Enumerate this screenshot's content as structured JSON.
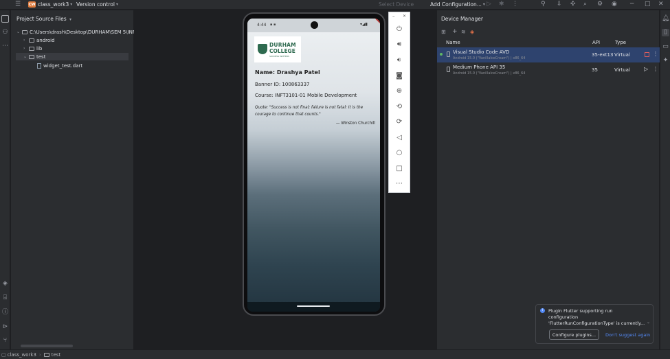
{
  "titlebar": {
    "project_badge": "CW",
    "project_name": "class_work3",
    "version_control": "Version control",
    "select_device": "Select Device",
    "run_config": "Add Configuration..."
  },
  "project_panel": {
    "title": "Project Source Files",
    "root_path": "C:\\Users\\drash\\Desktop\\DURHAM\\SEM 5\\INFT",
    "items": [
      {
        "label": "android"
      },
      {
        "label": "lib"
      },
      {
        "label": "test"
      },
      {
        "label": "widget_test.dart"
      }
    ]
  },
  "phone": {
    "status_time": "4:44",
    "college_line1": "DURHAM",
    "college_line2": "COLLEGE",
    "college_tagline": "SUCCESS MATTERS",
    "name": "Name: Drashya Patel",
    "banner_id": "Banner ID: 100863337",
    "course": "Course: INFT3101-01 Mobile Development",
    "quote_line1": "Quote: \"Success is not final; failure is not fatal: It is the",
    "quote_line2": "courage to continue that counts.\"",
    "quote_author": "— Winston Churchill"
  },
  "device_manager": {
    "title": "Device Manager",
    "columns": {
      "name": "Name",
      "api": "API",
      "type": "Type"
    },
    "devices": [
      {
        "name": "Visual Studio Code AVD",
        "sub": "Android 15.0 (\"VanillaIceCream\") | x86_64",
        "api": "35-ext13",
        "type": "Virtual"
      },
      {
        "name": "Medium Phone API 35",
        "sub": "Android 15.0 (\"VanillaIceCream\") | x86_64",
        "api": "35",
        "type": "Virtual"
      }
    ]
  },
  "notification": {
    "line1": "Plugin Flutter supporting run",
    "line2": "configuration",
    "line3": "'FlutterRunConfigurationType' is currently...",
    "button": "Configure plugins...",
    "link": "Don't suggest again"
  },
  "statusbar": {
    "crumb1": "class_work3",
    "crumb2": "test"
  }
}
